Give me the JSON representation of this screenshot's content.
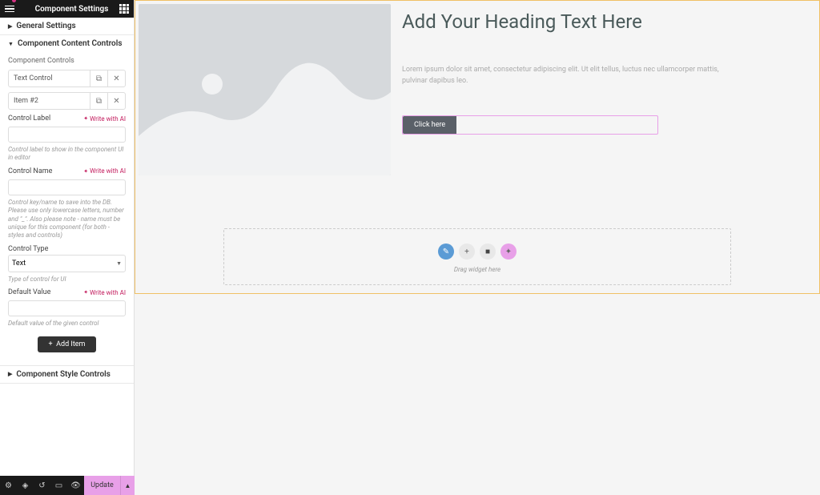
{
  "header": {
    "title": "Component Settings"
  },
  "accordion": {
    "general": "General Settings",
    "content": "Component Content Controls",
    "style": "Component Style Controls"
  },
  "controls": {
    "section_label": "Component Controls",
    "items": [
      {
        "label": "Text Control"
      },
      {
        "label": "Item #2"
      }
    ],
    "fields": {
      "label": {
        "label": "Control Label",
        "help": "Control label to show in the component UI in editor"
      },
      "name": {
        "label": "Control Name",
        "help": "Control key/name to save into the DB. Please use only lowercase letters, number and \"_\". Also please note - name must be unique for this component (for both - styles and controls)"
      },
      "type": {
        "label": "Control Type",
        "value": "Text",
        "help": "Type of control for UI"
      },
      "default": {
        "label": "Default Value",
        "help": "Default value of the given control"
      }
    },
    "ai_link": "Write with AI",
    "add_item": "Add Item"
  },
  "bottom": {
    "update": "Update"
  },
  "canvas": {
    "heading": "Add Your Heading Text Here",
    "paragraph": "Lorem ipsum dolor sit amet, consectetur adipiscing elit. Ut elit tellus, luctus nec ullamcorper mattis, pulvinar dapibus leo.",
    "cta": "Click here",
    "drop_text": "Drag widget here"
  }
}
